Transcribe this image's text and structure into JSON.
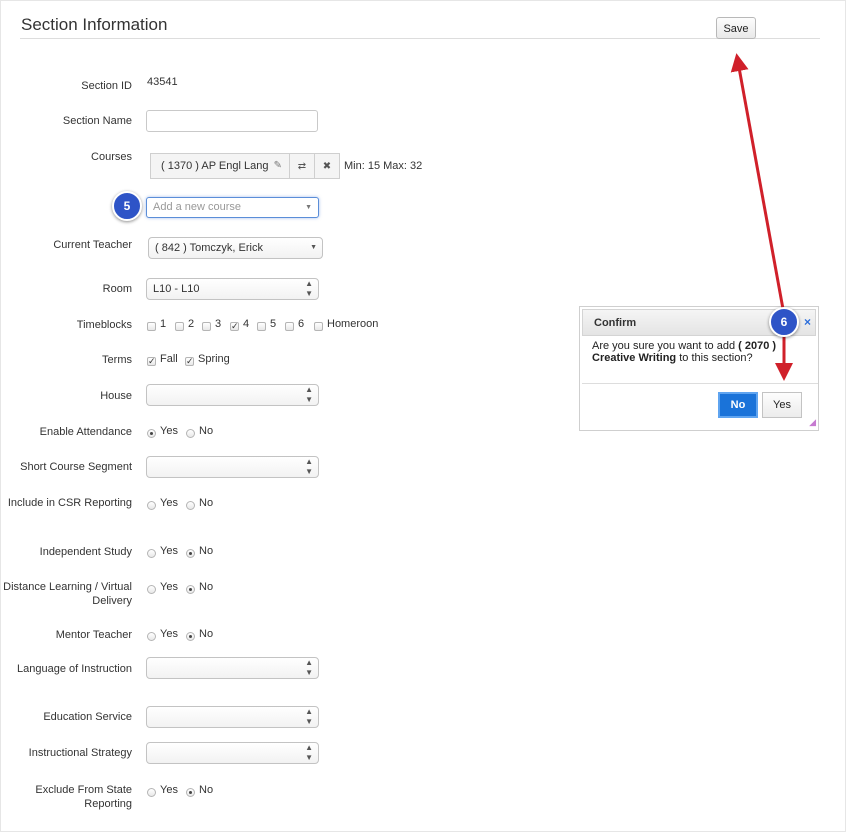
{
  "header": {
    "title": "Section Information",
    "save_label": "Save"
  },
  "form": {
    "section_id_label": "Section ID",
    "section_id_value": "43541",
    "section_name_label": "Section Name",
    "section_name_value": "",
    "courses_label": "Courses",
    "course_tag": "( 1370 ) AP Engl Lang",
    "min_max": "Min: 15 Max: 32",
    "add_course_placeholder": "Add a new course",
    "teacher_label": "Current Teacher",
    "teacher_value": "( 842 ) Tomczyk, Erick",
    "room_label": "Room",
    "room_value": "L10 - L10",
    "timeblocks_label": "Timeblocks",
    "timeblocks": [
      {
        "label": "1",
        "checked": false
      },
      {
        "label": "2",
        "checked": false
      },
      {
        "label": "3",
        "checked": false
      },
      {
        "label": "4",
        "checked": true
      },
      {
        "label": "5",
        "checked": false
      },
      {
        "label": "6",
        "checked": false
      },
      {
        "label": "Homeroon",
        "checked": false
      }
    ],
    "terms_label": "Terms",
    "terms": [
      {
        "label": "Fall",
        "checked": true
      },
      {
        "label": "Spring",
        "checked": true
      }
    ],
    "house_label": "House",
    "attendance_label": "Enable Attendance",
    "short_course_label": "Short Course Segment",
    "csr_label": "Include in CSR Reporting",
    "independent_label": "Independent Study",
    "distance_label": "Distance Learning / Virtual Delivery",
    "mentor_label": "Mentor Teacher",
    "language_label": "Language of Instruction",
    "education_service_label": "Education Service",
    "instructional_strategy_label": "Instructional Strategy",
    "exclude_label": "Exclude From State Reporting",
    "yes": "Yes",
    "no": "No",
    "radios": {
      "attendance": "Yes",
      "csr": "none",
      "independent": "No",
      "distance": "No",
      "mentor": "No",
      "exclude": "No"
    }
  },
  "dialog": {
    "title": "Confirm",
    "close_icon": "×",
    "message_pre": "Are you sure you want to add",
    "message_bold": "( 2070 ) Creative Writing",
    "message_post": "to this section?",
    "no_label": "No",
    "yes_label": "Yes"
  },
  "callouts": {
    "step5": "5",
    "step6": "6"
  },
  "icons": {
    "pencil": "pencil-icon",
    "swap": "swap-icon",
    "remove": "remove-icon"
  },
  "colors": {
    "callout": "#2e54c7",
    "arrow": "#d0202a",
    "primary_button": "#1a73d9"
  }
}
